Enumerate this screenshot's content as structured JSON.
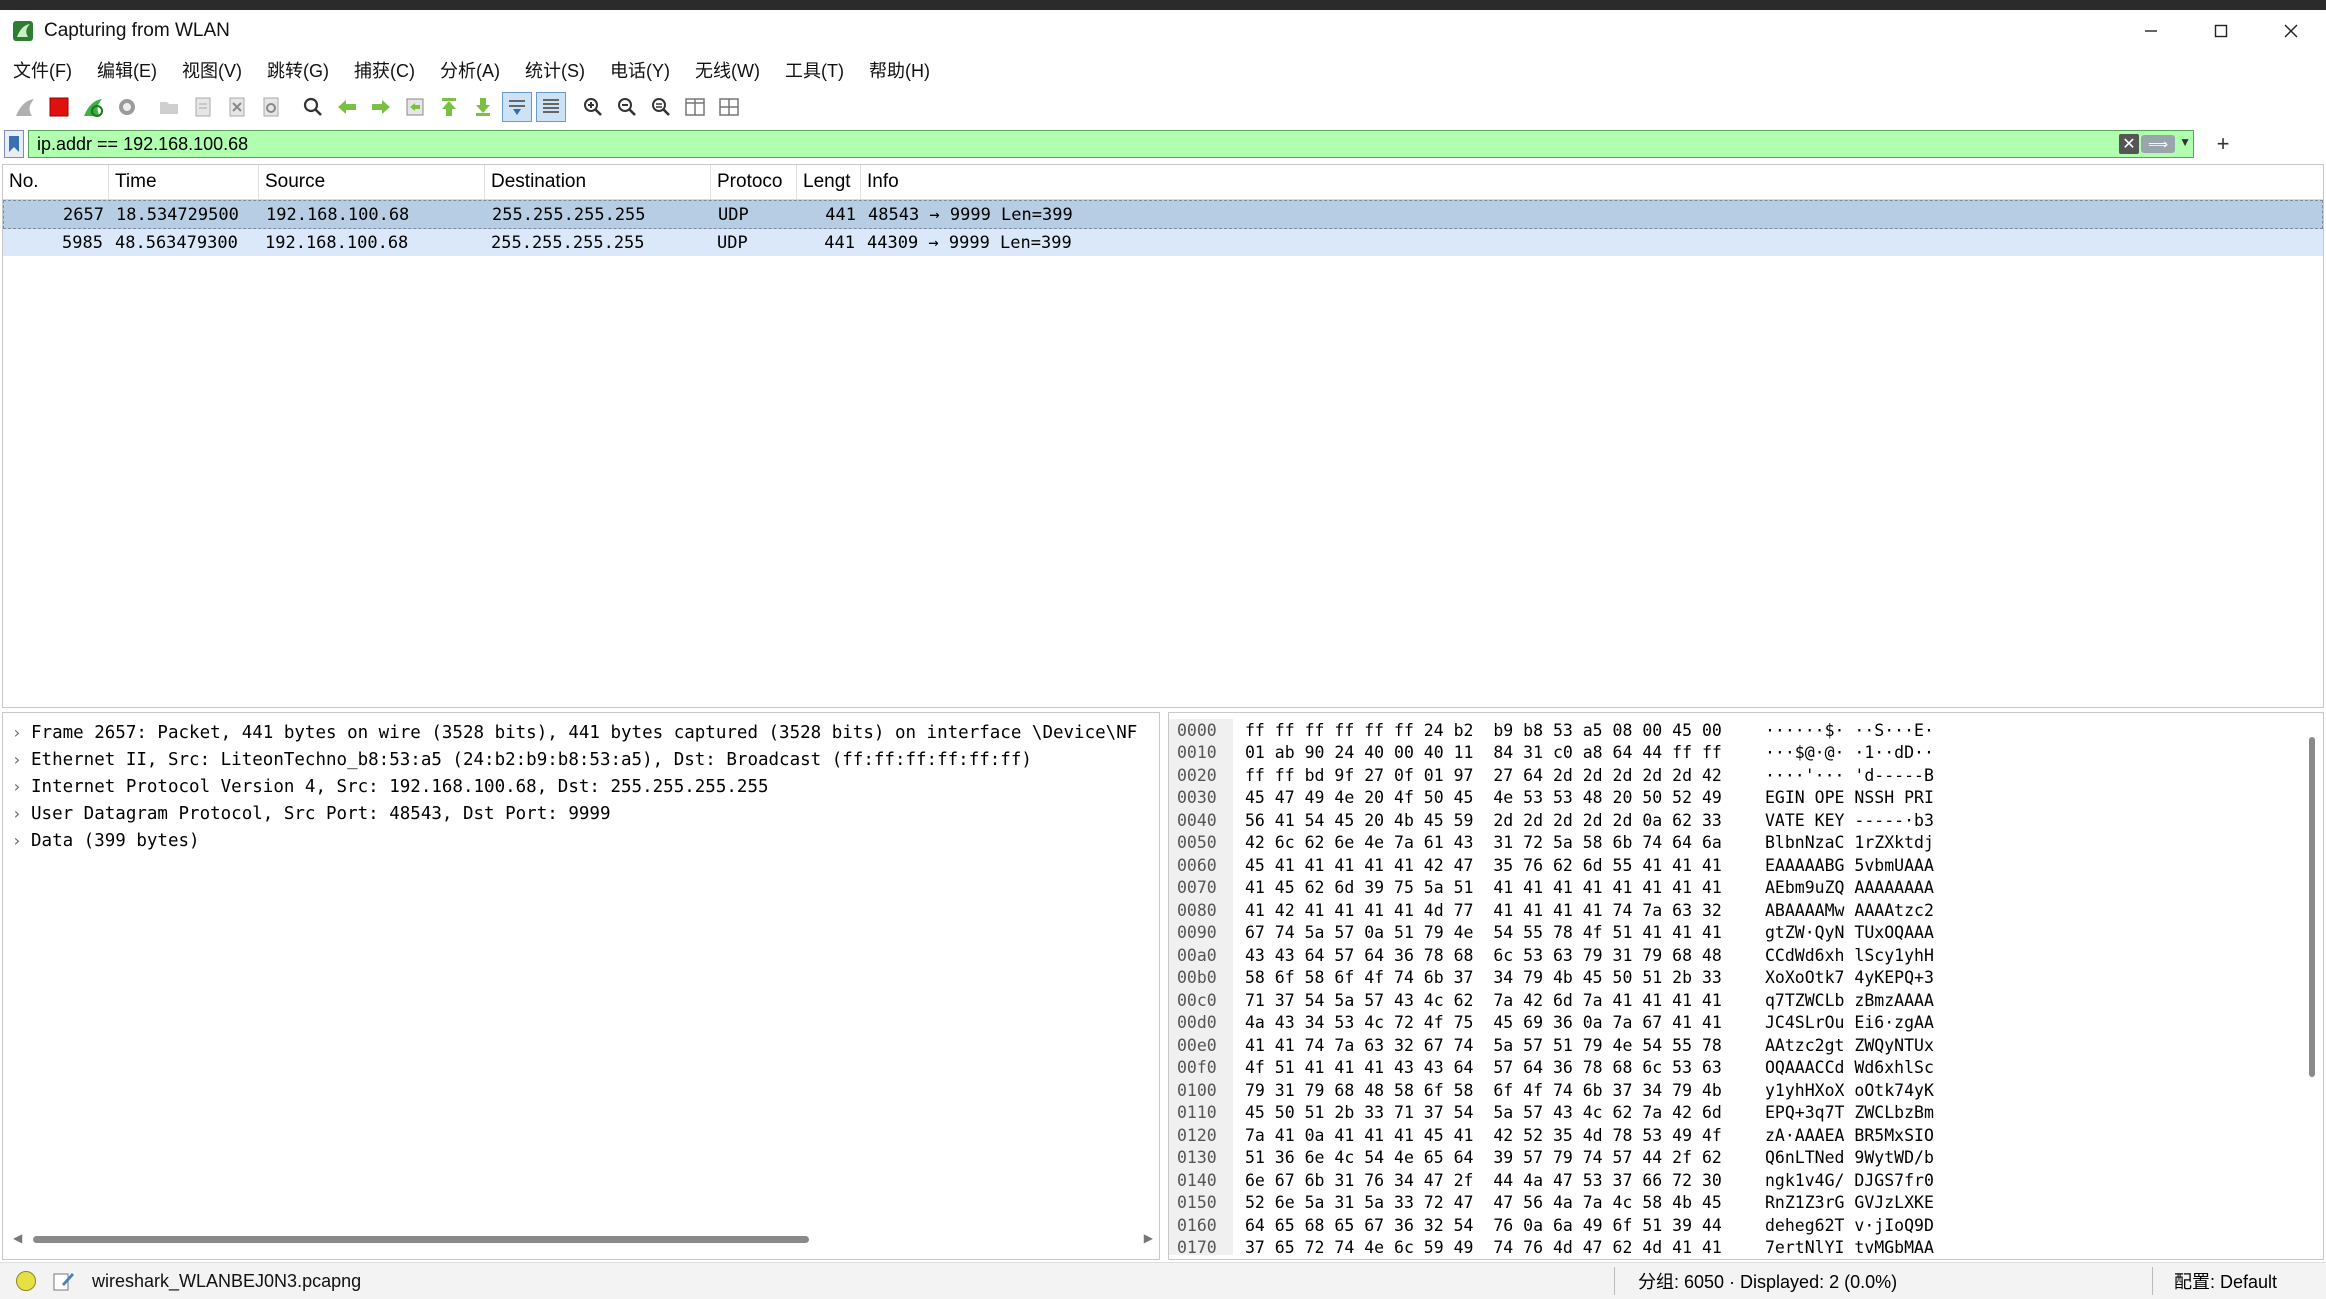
{
  "window": {
    "title": "Capturing from WLAN"
  },
  "menu": [
    "文件(F)",
    "编辑(E)",
    "视图(V)",
    "跳转(G)",
    "捕获(C)",
    "分析(A)",
    "统计(S)",
    "电话(Y)",
    "无线(W)",
    "工具(T)",
    "帮助(H)"
  ],
  "filter": {
    "value": "ip.addr == 192.168.100.68"
  },
  "packet_list": {
    "columns": [
      "No.",
      "Time",
      "Source",
      "Destination",
      "Protoco",
      "Lengt",
      "Info"
    ],
    "rows": [
      {
        "no": "2657",
        "time": "18.534729500",
        "src": "192.168.100.68",
        "dst": "255.255.255.255",
        "proto": "UDP",
        "len": "441",
        "info": "48543 → 9999 Len=399"
      },
      {
        "no": "5985",
        "time": "48.563479300",
        "src": "192.168.100.68",
        "dst": "255.255.255.255",
        "proto": "UDP",
        "len": "441",
        "info": "44309 → 9999 Len=399"
      }
    ]
  },
  "details": [
    "Frame 2657: Packet, 441 bytes on wire (3528 bits), 441 bytes captured (3528 bits) on interface \\Device\\NF",
    "Ethernet II, Src: LiteonTechno_b8:53:a5 (24:b2:b9:b8:53:a5), Dst: Broadcast (ff:ff:ff:ff:ff:ff)",
    "Internet Protocol Version 4, Src: 192.168.100.68, Dst: 255.255.255.255",
    "User Datagram Protocol, Src Port: 48543, Dst Port: 9999",
    "Data (399 bytes)"
  ],
  "hex": [
    {
      "off": "0000",
      "bytes": "ff ff ff ff ff ff 24 b2  b9 b8 53 a5 08 00 45 00",
      "ascii": "······$· ··S···E·"
    },
    {
      "off": "0010",
      "bytes": "01 ab 90 24 40 00 40 11  84 31 c0 a8 64 44 ff ff",
      "ascii": "···$@·@· ·1··dD··"
    },
    {
      "off": "0020",
      "bytes": "ff ff bd 9f 27 0f 01 97  27 64 2d 2d 2d 2d 2d 42",
      "ascii": "····'··· 'd-----B"
    },
    {
      "off": "0030",
      "bytes": "45 47 49 4e 20 4f 50 45  4e 53 53 48 20 50 52 49",
      "ascii": "EGIN OPE NSSH PRI"
    },
    {
      "off": "0040",
      "bytes": "56 41 54 45 20 4b 45 59  2d 2d 2d 2d 2d 0a 62 33",
      "ascii": "VATE KEY -----·b3"
    },
    {
      "off": "0050",
      "bytes": "42 6c 62 6e 4e 7a 61 43  31 72 5a 58 6b 74 64 6a",
      "ascii": "BlbnNzaC 1rZXktdj"
    },
    {
      "off": "0060",
      "bytes": "45 41 41 41 41 41 42 47  35 76 62 6d 55 41 41 41",
      "ascii": "EAAAAABG 5vbmUAAA"
    },
    {
      "off": "0070",
      "bytes": "41 45 62 6d 39 75 5a 51  41 41 41 41 41 41 41 41",
      "ascii": "AEbm9uZQ AAAAAAAA"
    },
    {
      "off": "0080",
      "bytes": "41 42 41 41 41 41 4d 77  41 41 41 41 74 7a 63 32",
      "ascii": "ABAAAAMw AAAAtzc2"
    },
    {
      "off": "0090",
      "bytes": "67 74 5a 57 0a 51 79 4e  54 55 78 4f 51 41 41 41",
      "ascii": "gtZW·QyN TUxOQAAA"
    },
    {
      "off": "00a0",
      "bytes": "43 43 64 57 64 36 78 68  6c 53 63 79 31 79 68 48",
      "ascii": "CCdWd6xh lScy1yhH"
    },
    {
      "off": "00b0",
      "bytes": "58 6f 58 6f 4f 74 6b 37  34 79 4b 45 50 51 2b 33",
      "ascii": "XoXoOtk7 4yKEPQ+3"
    },
    {
      "off": "00c0",
      "bytes": "71 37 54 5a 57 43 4c 62  7a 42 6d 7a 41 41 41 41",
      "ascii": "q7TZWCLb zBmzAAAA"
    },
    {
      "off": "00d0",
      "bytes": "4a 43 34 53 4c 72 4f 75  45 69 36 0a 7a 67 41 41",
      "ascii": "JC4SLrOu Ei6·zgAA"
    },
    {
      "off": "00e0",
      "bytes": "41 41 74 7a 63 32 67 74  5a 57 51 79 4e 54 55 78",
      "ascii": "AAtzc2gt ZWQyNTUx"
    },
    {
      "off": "00f0",
      "bytes": "4f 51 41 41 41 43 43 64  57 64 36 78 68 6c 53 63",
      "ascii": "OQAAACCd Wd6xhlSc"
    },
    {
      "off": "0100",
      "bytes": "79 31 79 68 48 58 6f 58  6f 4f 74 6b 37 34 79 4b",
      "ascii": "y1yhHXoX oOtk74yK"
    },
    {
      "off": "0110",
      "bytes": "45 50 51 2b 33 71 37 54  5a 57 43 4c 62 7a 42 6d",
      "ascii": "EPQ+3q7T ZWCLbzBm"
    },
    {
      "off": "0120",
      "bytes": "7a 41 0a 41 41 41 45 41  42 52 35 4d 78 53 49 4f",
      "ascii": "zA·AAAEA BR5MxSIO"
    },
    {
      "off": "0130",
      "bytes": "51 36 6e 4c 54 4e 65 64  39 57 79 74 57 44 2f 62",
      "ascii": "Q6nLTNed 9WytWD/b"
    },
    {
      "off": "0140",
      "bytes": "6e 67 6b 31 76 34 47 2f  44 4a 47 53 37 66 72 30",
      "ascii": "ngk1v4G/ DJGS7fr0"
    },
    {
      "off": "0150",
      "bytes": "52 6e 5a 31 5a 33 72 47  47 56 4a 7a 4c 58 4b 45",
      "ascii": "RnZ1Z3rG GVJzLXKE"
    },
    {
      "off": "0160",
      "bytes": "64 65 68 65 67 36 32 54  76 0a 6a 49 6f 51 39 44",
      "ascii": "deheg62T v·jIoQ9D"
    },
    {
      "off": "0170",
      "bytes": "37 65 72 74 4e 6c 59 49  74 76 4d 47 62 4d 41 41",
      "ascii": "7ertNlYI tvMGbMAA"
    }
  ],
  "status": {
    "file": "wireshark_WLANBEJ0N3.pcapng",
    "packets": "分组: 6050 · Displayed: 2 (0.0%)",
    "profile": "配置:  Default"
  }
}
